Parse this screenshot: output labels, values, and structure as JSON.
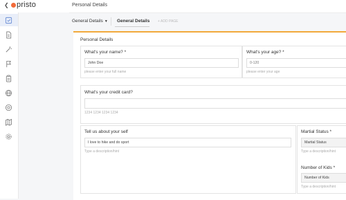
{
  "app": {
    "brand": "pristo",
    "page_title": "Personal Details"
  },
  "tabs": {
    "dropdown_label": "General Details",
    "active_tab": "General Details",
    "add_page": "+ ADD PAGE"
  },
  "form": {
    "section_title": "Personal Details",
    "name": {
      "label": "What's your name? *",
      "value": "John Doe",
      "hint": "please enter your full name"
    },
    "age": {
      "label": "What's your age? *",
      "placeholder": "0-120",
      "hint": "please enter your age"
    },
    "credit_card": {
      "label": "What's your credit card?",
      "placeholder": "",
      "hint": "1234 1234 1234 1234"
    },
    "about": {
      "label": "Tell us about your self",
      "value": "I love to hike and do sport",
      "hint": "Type a description/hint"
    },
    "marital": {
      "label": "Martial Status *",
      "value": "Martial Status",
      "hint": "Type a description/hint"
    },
    "kids": {
      "label": "Number of Kids *",
      "value": "Number of Kids",
      "hint": "Type a description/hint"
    }
  },
  "sidebar": {
    "icons": [
      "form-icon",
      "document-icon",
      "magic-wand-icon",
      "flag-icon",
      "clipboard-icon",
      "globe-icon",
      "at-sign-icon",
      "map-icon",
      "settings-icon"
    ]
  }
}
